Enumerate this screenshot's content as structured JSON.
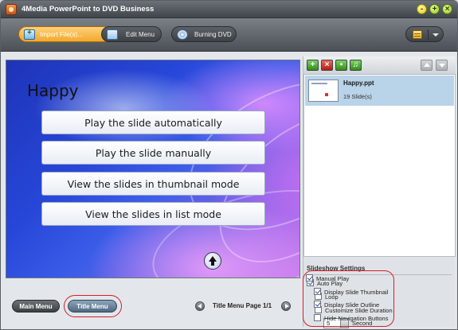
{
  "window": {
    "title": "4Media PowerPoint to DVD Business"
  },
  "toolbar": {
    "import_label": "Import File(s)...",
    "edit_label": "Edit Menu",
    "burn_label": "Burning DVD"
  },
  "preview": {
    "heading": "Happy",
    "buttons": [
      "Play the slide automatically",
      "Play the slide manually",
      "View the slides in thumbnail mode",
      "View the slides in list mode"
    ]
  },
  "bottom": {
    "main_menu_label": "Main Menu",
    "title_menu_label": "Title Menu",
    "page_text": "Title Menu Page 1/1"
  },
  "files": [
    {
      "name": "Happy.ppt",
      "slides": "19 Slide(s)"
    }
  ],
  "settings": {
    "title": "Slideshow Settings",
    "auto_play": {
      "label": "Auto Play",
      "checked": true
    },
    "loop": {
      "label": "Loop",
      "checked": false
    },
    "customize": {
      "label": "Customize Slide Duration",
      "checked": false
    },
    "duration": {
      "value": "5",
      "unit": "Second"
    },
    "manual_play": {
      "label": "Manual Play",
      "checked": true
    },
    "display_thumbnail": {
      "label": "Display Slide Thumbnail",
      "checked": true
    },
    "display_outline": {
      "label": "Display Slide Outline",
      "checked": true
    },
    "hide_nav": {
      "label": "Hide Navigation Buttons",
      "checked": false
    }
  },
  "colors": {
    "highlight_oval": "#d1202a",
    "selection": "#b9d3e8",
    "import_accent": "#f0a92c"
  }
}
